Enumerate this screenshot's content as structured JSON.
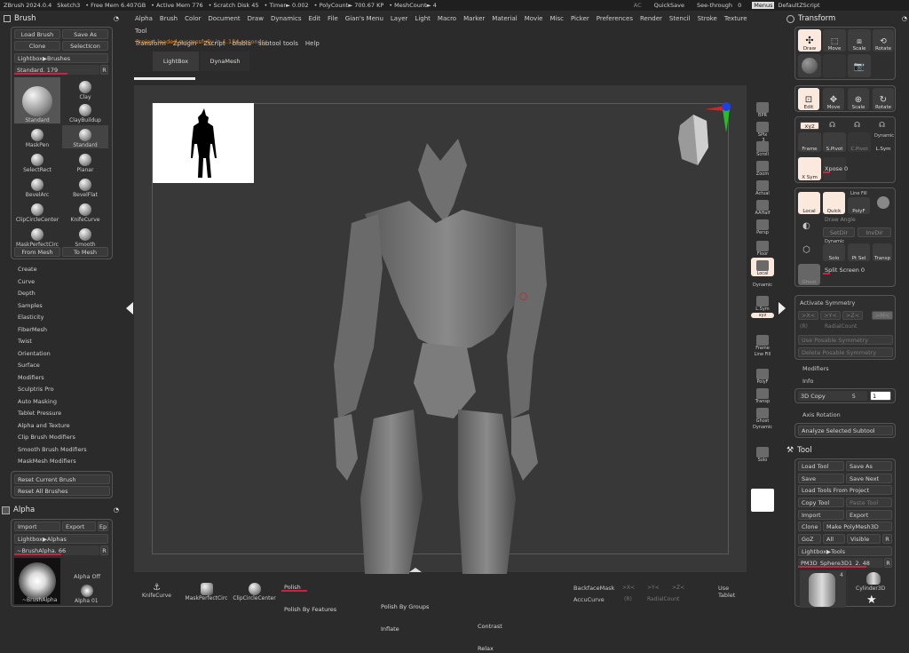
{
  "topbar": {
    "items": [
      "ZBrush 2024.0.4",
      "Sketch3",
      "• Free Mem 6.407GB",
      "• Active Mem 776",
      "• Scratch Disk 45",
      "• Timer► 0.002",
      "• PolyCount► 700.67 KP",
      "• MeshCount► 4"
    ],
    "ac": "AC",
    "quicksave": "QuickSave",
    "seethrough": "See-through",
    "seethrough_val": "0",
    "menus": "Menus",
    "zscript": "DefaultZScript"
  },
  "menu": {
    "row1": [
      "Alpha",
      "Brush",
      "Color",
      "Document",
      "Draw",
      "Dynamics",
      "Edit",
      "File",
      "Gian's Menu",
      "Layer",
      "Light",
      "Macro",
      "Marker",
      "Material",
      "Movie",
      "Misc",
      "Picker",
      "Preferences",
      "Render",
      "Stencil",
      "Stroke",
      "Texture",
      "Tool"
    ],
    "row2": [
      "Transform",
      "Zplugin",
      "Zscript",
      "blabla",
      "subtool tools",
      "Help"
    ]
  },
  "status": "Project loaded successfully in 1.134 seconds.",
  "doc_tabs": [
    "LightBox",
    "DynaMesh"
  ],
  "brush": {
    "title": "Brush",
    "load": "Load Brush",
    "save_as": "Save As",
    "clone": "Clone",
    "select_icon": "SelectIcon",
    "lightbox": "Lightbox▶Brushes",
    "standard_label": "Standard.",
    "standard_val": "179",
    "r": "R",
    "tiles": [
      {
        "label": "Standard"
      },
      {
        "label": "Clay"
      },
      {
        "label": "ClayBuildup"
      },
      {
        "label": "MaskPen"
      },
      {
        "label": "Standard"
      },
      {
        "label": "SelectRect"
      },
      {
        "label": "Planar"
      },
      {
        "label": "BevelArc"
      },
      {
        "label": "BevelFlat"
      },
      {
        "label": "ClipCircleCenter"
      },
      {
        "label": "KnifeCurve"
      },
      {
        "label": "MaskPerfectCirc"
      },
      {
        "label": "Smooth"
      }
    ],
    "from_mesh": "From Mesh",
    "to_mesh": "To Mesh",
    "submenus": [
      "Create",
      "Curve",
      "Depth",
      "Samples",
      "Elasticity",
      "FiberMesh",
      "Twist",
      "Orientation",
      "Surface",
      "Modifiers",
      "Sculptris Pro",
      "Auto Masking",
      "Tablet Pressure",
      "Alpha and Texture",
      "Clip Brush Modifiers",
      "Smooth Brush Modifiers",
      "MaskMesh Modifiers"
    ],
    "reset_current": "Reset Current Brush",
    "reset_all": "Reset All Brushes"
  },
  "alpha": {
    "title": "Alpha",
    "import": "Import",
    "export": "Export",
    "ep": "Ep",
    "lightbox": "Lightbox▶Alphas",
    "brush_alpha": "~BrushAlpha.",
    "brush_alpha_val": "66",
    "r": "R",
    "alpha_off": "Alpha Off",
    "thumb_label": "~BrushAlpha",
    "alpha01": "Alpha 01"
  },
  "shelf": [
    {
      "label": "BPR"
    },
    {
      "label": "SPix",
      "val": "3"
    },
    {
      "label": "Scroll"
    },
    {
      "label": "Zoom"
    },
    {
      "label": "Actual"
    },
    {
      "label": "AAHalf"
    },
    {
      "label": "Persp"
    },
    {
      "label": "Floor"
    },
    {
      "label": "Local"
    },
    {
      "label": "Dynamic"
    },
    {
      "label": "L.Sym"
    },
    {
      "label": "xyz"
    },
    {
      "label": "Frame"
    },
    {
      "label": "Line Fill"
    },
    {
      "label": "PolyF"
    },
    {
      "label": "Transp"
    },
    {
      "label": "Ghost"
    },
    {
      "label": "Dynamic"
    },
    {
      "label": "Solo"
    }
  ],
  "transform": {
    "title": "Transform",
    "row1": [
      "Draw",
      "Move",
      "Scale",
      "Rotate"
    ],
    "row2": [
      "Edit",
      "Move",
      "Scale",
      "Rotate"
    ],
    "sym": [
      "xyz",
      "Frame",
      "S.Pivot",
      "C.Pivot",
      "Dynamic",
      "L.Sym"
    ],
    "xsym": "X Sym",
    "xpose": "Xpose",
    "xpose_val": "0",
    "local": "Local",
    "quick": "Quick",
    "linefill": "Line Fill",
    "polyf": "PolyF",
    "draw_angle": "Draw Angle",
    "setdir": "SetDir",
    "invdir": "InvDir",
    "dynamic": "Dynamic",
    "solo": "Solo",
    "ptsel": "Pt Sel",
    "transp": "Transp",
    "split_screen": "Split Screen",
    "split_val": "0",
    "ghost": "Ghost",
    "activate_sym": "Activate Symmetry",
    "axes": [
      ">X<",
      ">Y<",
      ">Z<",
      ">M<"
    ],
    "r": "(R)",
    "radial": "RadialCount",
    "use_posable": "Use Posable Symmetry",
    "delete_posable": "Delete Posable Symmetry",
    "modifiers": "Modifiers",
    "info": "Info",
    "copy3d": "3D Copy",
    "copy3d_val": "5",
    "copy3d_val2": "1",
    "axis_rotation": "Axis Rotation",
    "analyze": "Analyze Selected Subtool"
  },
  "tool": {
    "title": "Tool",
    "load": "Load Tool",
    "save_as": "Save As",
    "save": "Save",
    "save_next": "Save Next",
    "load_project": "Load Tools From Project",
    "copy": "Copy Tool",
    "paste": "Paste Tool",
    "import": "Import",
    "export": "Export",
    "clone": "Clone",
    "make_poly": "Make PolyMesh3D",
    "goz": "GoZ",
    "all": "All",
    "visible": "Visible",
    "r": "R",
    "lightbox": "Lightbox▶Tools",
    "current": "PM3D_Sphere3D1_2.",
    "current_val": "48",
    "thumb_count": "4",
    "cyl": "Cylinder3D"
  },
  "bottom": {
    "tools": [
      "KnifeCurve",
      "MaskPerfectCirc",
      "ClipCircleCenter"
    ],
    "polish": "Polish",
    "polish_features": "Polish By Features",
    "polish_groups": "Polish By Groups",
    "inflate": "Inflate",
    "contrast": "Contrast",
    "relax": "Relax",
    "backface": "BackfaceMask",
    "accucurve": "AccuCurve",
    "axes": [
      ">X<",
      ">Y<",
      ">Z<"
    ],
    "r": "(R)",
    "radial": "RadialCount",
    "use_tablet": "Use Tablet"
  },
  "colors": {
    "accent": "#e06b18",
    "bg": "#2b2b2b",
    "canvas": "#3c3c3c"
  }
}
